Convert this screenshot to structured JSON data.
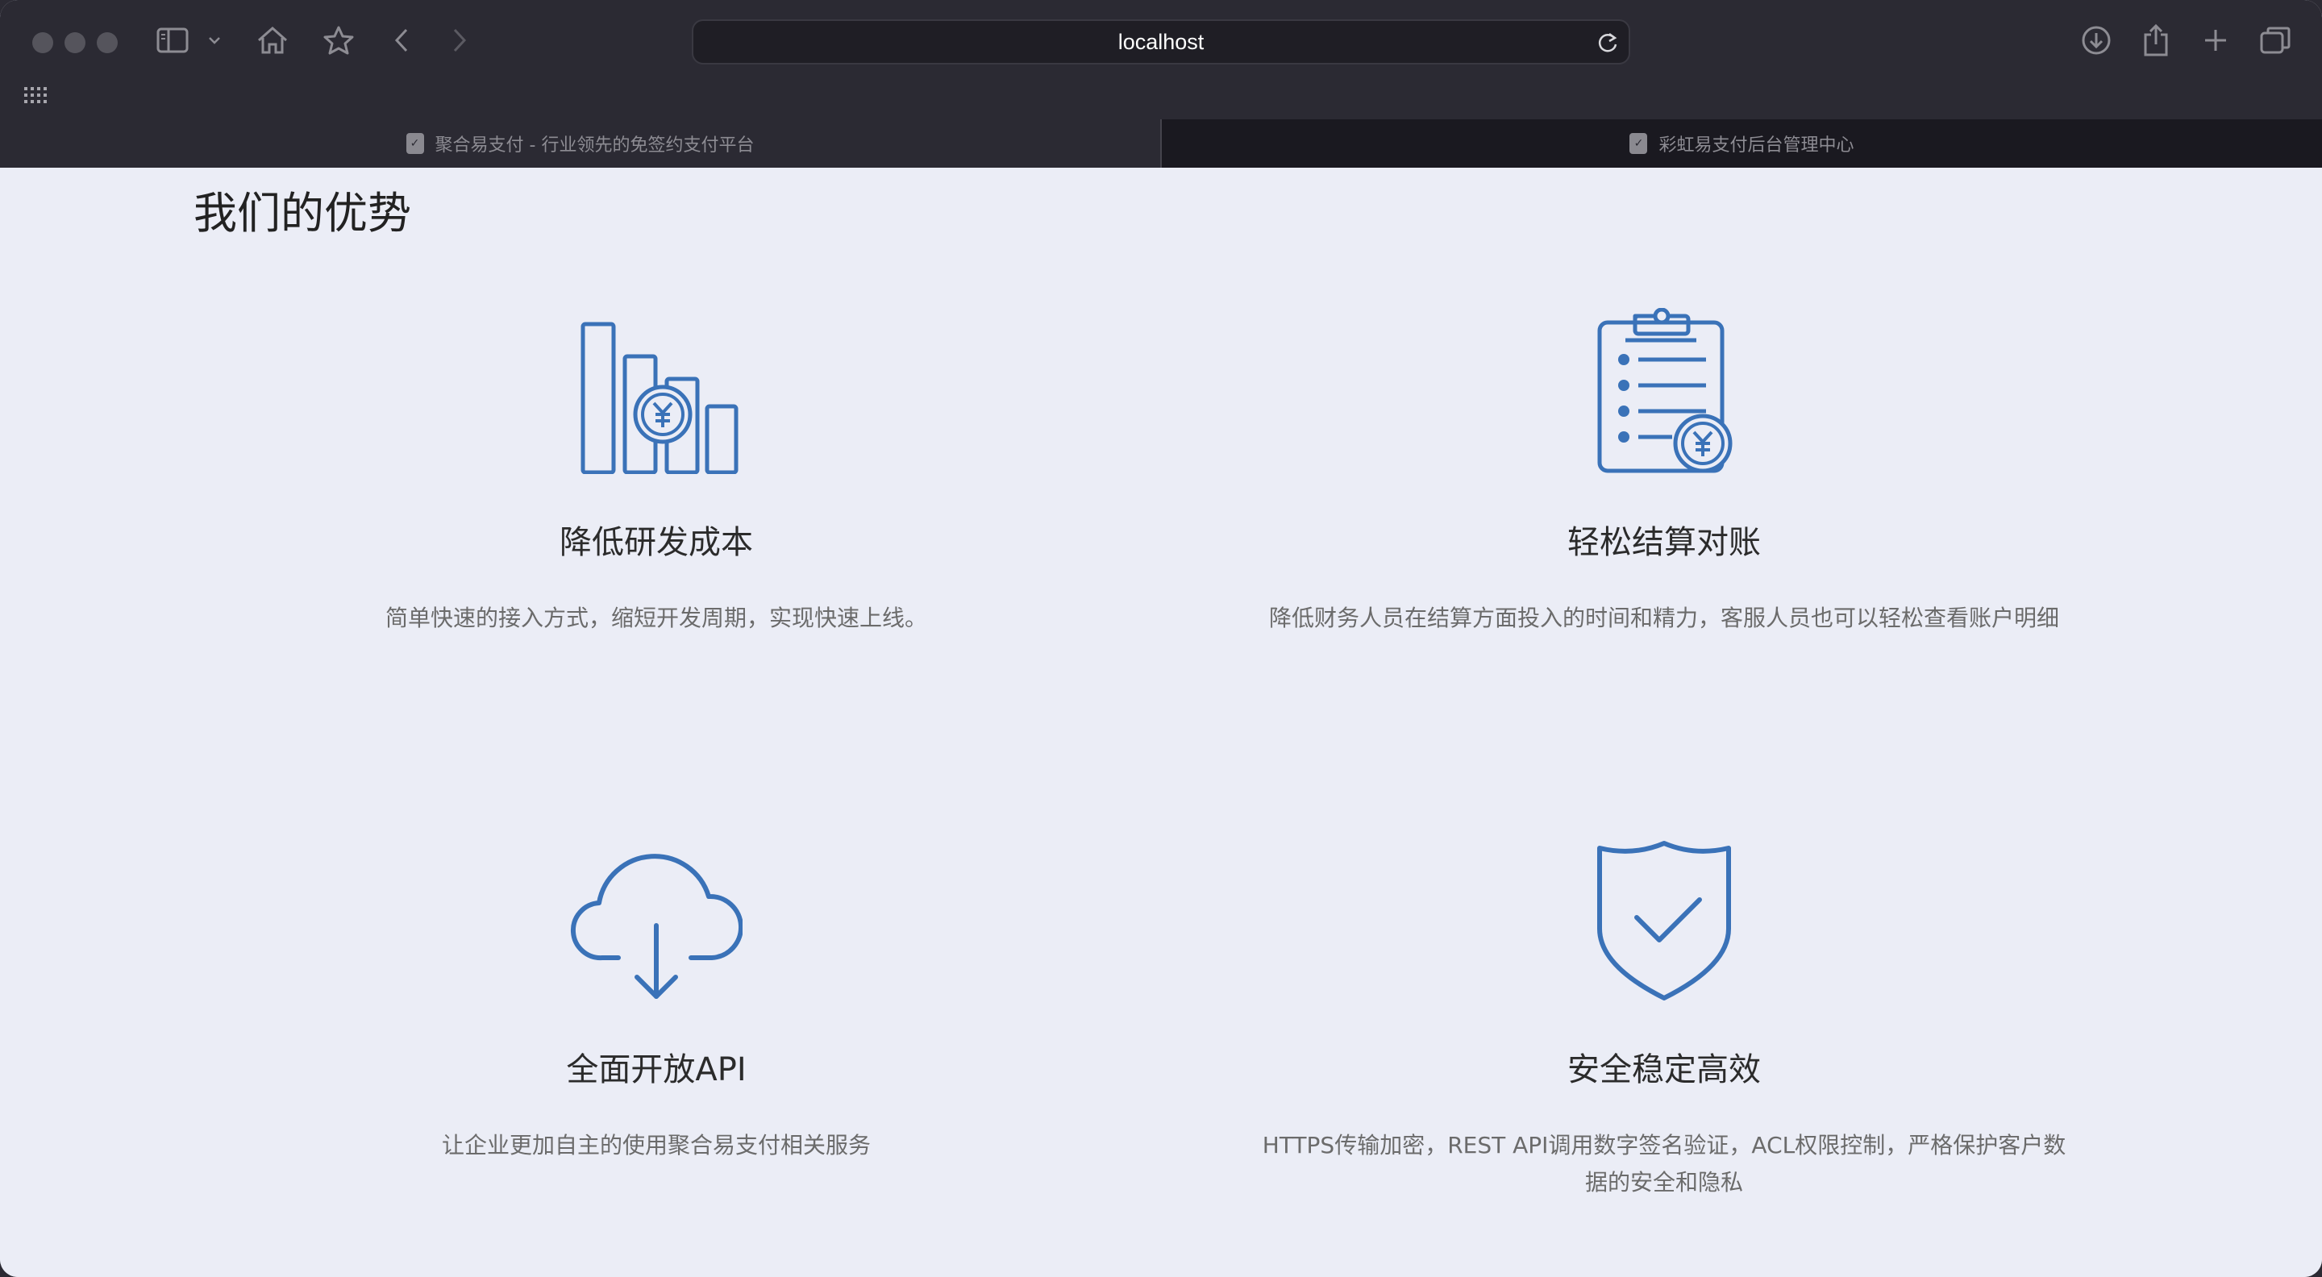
{
  "browser": {
    "address": "localhost",
    "tabs": [
      {
        "title": "聚合易支付 - 行业领先的免签约支付平台",
        "active": false
      },
      {
        "title": "彩虹易支付后台管理中心",
        "active": true
      }
    ]
  },
  "section": {
    "title": "我们的优势"
  },
  "features": [
    {
      "icon": "bar-chart-yuan-icon",
      "title": "降低研发成本",
      "desc": "简单快速的接入方式，缩短开发周期，实现快速上线。"
    },
    {
      "icon": "clipboard-yuan-icon",
      "title": "轻松结算对账",
      "desc": "降低财务人员在结算方面投入的时间和精力，客服人员也可以轻松查看账户明细"
    },
    {
      "icon": "cloud-download-icon",
      "title": "全面开放API",
      "desc": "让企业更加自主的使用聚合易支付相关服务"
    },
    {
      "icon": "shield-check-icon",
      "title": "安全稳定高效",
      "desc": "HTTPS传输加密，REST API调用数字签名验证，ACL权限控制，严格保护客户数据的安全和隐私"
    }
  ],
  "colors": {
    "accent": "#3a72b8",
    "page_bg": "#ebedf6",
    "chrome_bg": "#2b2a33"
  }
}
